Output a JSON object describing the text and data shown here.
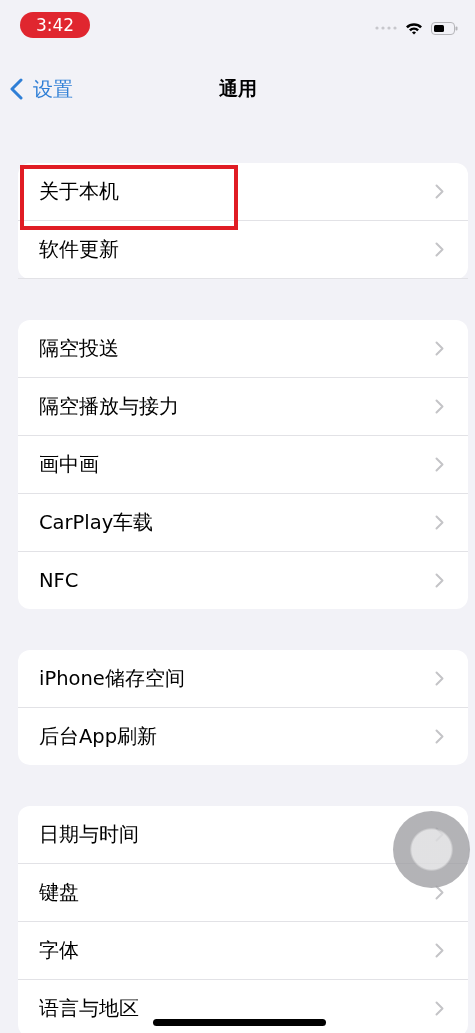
{
  "status_bar": {
    "time": "3:42"
  },
  "nav": {
    "back": "设置",
    "title": "通用"
  },
  "groups": [
    {
      "items": [
        {
          "label": "关于本机",
          "highlighted": true
        },
        {
          "label": "软件更新",
          "highlighted": false
        }
      ]
    },
    {
      "items": [
        {
          "label": "隔空投送",
          "highlighted": false
        },
        {
          "label": "隔空播放与接力",
          "highlighted": false
        },
        {
          "label": "画中画",
          "highlighted": false
        },
        {
          "label": "CarPlay车载",
          "highlighted": false
        },
        {
          "label": "NFC",
          "highlighted": false
        }
      ]
    },
    {
      "items": [
        {
          "label": "iPhone储存空间",
          "highlighted": false
        },
        {
          "label": "后台App刷新",
          "highlighted": false
        }
      ]
    },
    {
      "items": [
        {
          "label": "日期与时间",
          "highlighted": false
        },
        {
          "label": "键盘",
          "highlighted": false
        },
        {
          "label": "字体",
          "highlighted": false
        },
        {
          "label": "语言与地区",
          "highlighted": false
        }
      ]
    }
  ]
}
